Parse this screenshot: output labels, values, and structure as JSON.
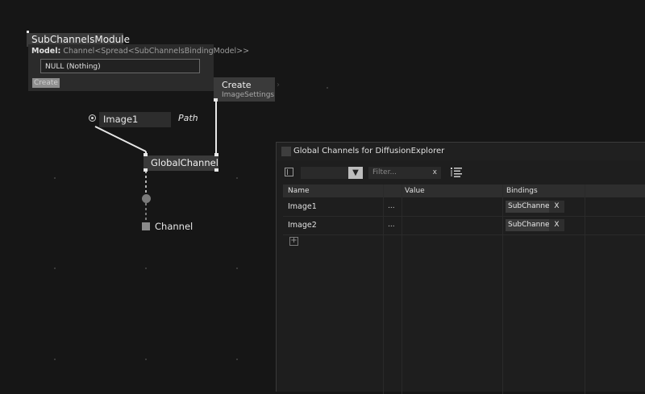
{
  "sub_channels_node": {
    "title": "SubChannelsModule",
    "model_label": "Model:",
    "model_value": "Channel<Spread<SubChannelsBindingModel>>",
    "null_value": "NULL (Nothing)",
    "create_label": "Create"
  },
  "create_node": {
    "title": "Create",
    "subtitle": "ImageSettings"
  },
  "image1_pin": {
    "label": "Image1",
    "path_label": "Path"
  },
  "global_channel_node": {
    "title": "GlobalChannel"
  },
  "channel_pin": {
    "label": "Channel"
  },
  "channels_window": {
    "title": "Global Channels for DiffusionExplorer",
    "filter_placeholder": "Filter...",
    "filter_clear": "x",
    "dropdown_arrow": "▼",
    "columns": [
      "Name",
      "Value",
      "Bindings"
    ],
    "rows": [
      {
        "name": "Image1",
        "value_button": "...",
        "binding": "SubChannels",
        "binding_remove": "X"
      },
      {
        "name": "Image2",
        "value_button": "...",
        "binding": "SubChannels",
        "binding_remove": "X"
      }
    ],
    "add_button": "+"
  },
  "icons": [
    "sidebar-toggle-icon",
    "dropdown-arrow-icon",
    "sort-list-icon",
    "add-icon",
    "pin-circle-icon"
  ]
}
